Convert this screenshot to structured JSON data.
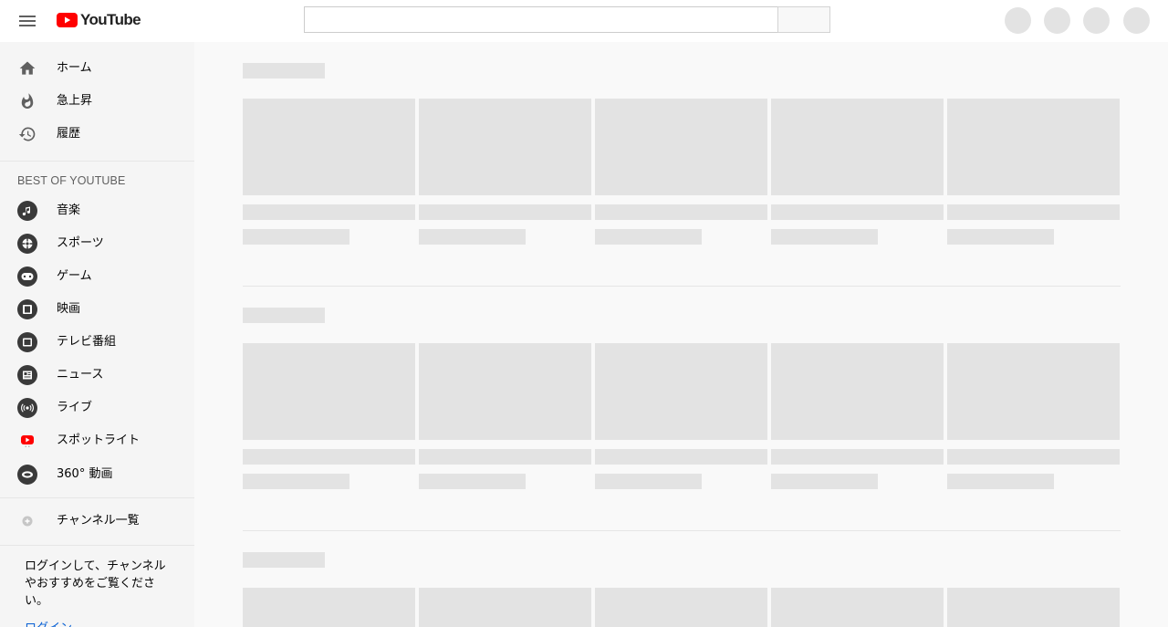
{
  "header": {
    "logo_text": "YouTube",
    "search_placeholder": "",
    "brand_color": "#ff0000"
  },
  "sidebar": {
    "main_items": [
      {
        "label": "ホーム",
        "icon": "home-icon"
      },
      {
        "label": "急上昇",
        "icon": "fire-icon"
      },
      {
        "label": "履歴",
        "icon": "history-icon"
      }
    ],
    "section_title": "BEST OF YOUTUBE",
    "best_items": [
      {
        "label": "音楽",
        "icon": "music-icon"
      },
      {
        "label": "スポーツ",
        "icon": "sports-icon"
      },
      {
        "label": "ゲーム",
        "icon": "gaming-icon"
      },
      {
        "label": "映画",
        "icon": "movies-icon"
      },
      {
        "label": "テレビ番組",
        "icon": "tv-icon"
      },
      {
        "label": "ニュース",
        "icon": "news-icon"
      },
      {
        "label": "ライブ",
        "icon": "live-icon"
      },
      {
        "label": "スポットライト",
        "icon": "spotlight-icon"
      },
      {
        "label": "360° 動画",
        "icon": "360-video-icon"
      }
    ],
    "channels_item": {
      "label": "チャンネル一覧",
      "icon": "add-channel-icon"
    },
    "signin_prompt": "ログインして、チャンネルやおすすめをご覧ください。",
    "signin_link": "ログイン"
  },
  "colors": {
    "skeleton": "#e3e3e3",
    "link": "#065fd4"
  }
}
